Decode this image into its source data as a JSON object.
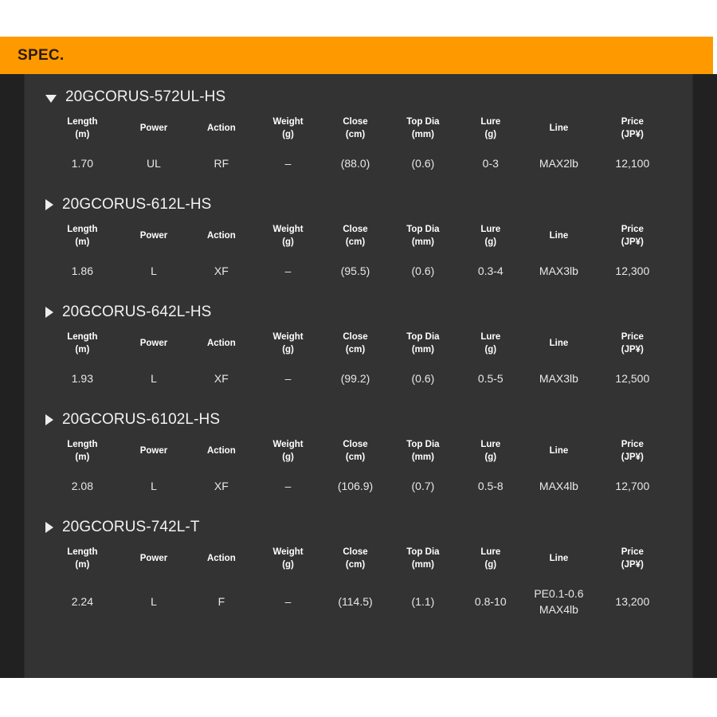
{
  "header": {
    "title": "SPEC.",
    "background_color": "#ff9900",
    "text_color": "#2b1b06"
  },
  "theme": {
    "panel_background": "#333333",
    "page_background": "#212121",
    "text_color": "#e8e8e8",
    "heading_color": "#f2f2f2"
  },
  "columns": [
    {
      "label": "Length",
      "unit": "(m)"
    },
    {
      "label": "Power",
      "unit": ""
    },
    {
      "label": "Action",
      "unit": ""
    },
    {
      "label": "Weight",
      "unit": "(g)"
    },
    {
      "label": "Close",
      "unit": "(cm)"
    },
    {
      "label": "Top Dia",
      "unit": "(mm)"
    },
    {
      "label": "Lure",
      "unit": "(g)"
    },
    {
      "label": "Line",
      "unit": ""
    },
    {
      "label": "Price",
      "unit": "(JP¥)"
    }
  ],
  "groups": [
    {
      "model": "20GCORUS-572UL-HS",
      "expanded": true,
      "marker": "triangle-down-icon",
      "row": {
        "length": "1.70",
        "power": "UL",
        "action": "RF",
        "weight": "–",
        "close": "(88.0)",
        "top_dia": "(0.6)",
        "lure": "0-3",
        "line": "MAX2lb",
        "line2": "",
        "price": "12,100"
      }
    },
    {
      "model": "20GCORUS-612L-HS",
      "expanded": false,
      "marker": "triangle-right-icon",
      "row": {
        "length": "1.86",
        "power": "L",
        "action": "XF",
        "weight": "–",
        "close": "(95.5)",
        "top_dia": "(0.6)",
        "lure": "0.3-4",
        "line": "MAX3lb",
        "line2": "",
        "price": "12,300"
      }
    },
    {
      "model": "20GCORUS-642L-HS",
      "expanded": false,
      "marker": "triangle-right-icon",
      "row": {
        "length": "1.93",
        "power": "L",
        "action": "XF",
        "weight": "–",
        "close": "(99.2)",
        "top_dia": "(0.6)",
        "lure": "0.5-5",
        "line": "MAX3lb",
        "line2": "",
        "price": "12,500"
      }
    },
    {
      "model": "20GCORUS-6102L-HS",
      "expanded": false,
      "marker": "triangle-right-icon",
      "row": {
        "length": "2.08",
        "power": "L",
        "action": "XF",
        "weight": "–",
        "close": "(106.9)",
        "top_dia": "(0.7)",
        "lure": "0.5-8",
        "line": "MAX4lb",
        "line2": "",
        "price": "12,700"
      }
    },
    {
      "model": "20GCORUS-742L-T",
      "expanded": false,
      "marker": "triangle-right-icon",
      "row": {
        "length": "2.24",
        "power": "L",
        "action": "F",
        "weight": "–",
        "close": "(114.5)",
        "top_dia": "(1.1)",
        "lure": "0.8-10",
        "line": "PE0.1-0.6",
        "line2": "MAX4lb",
        "price": "13,200"
      }
    }
  ]
}
